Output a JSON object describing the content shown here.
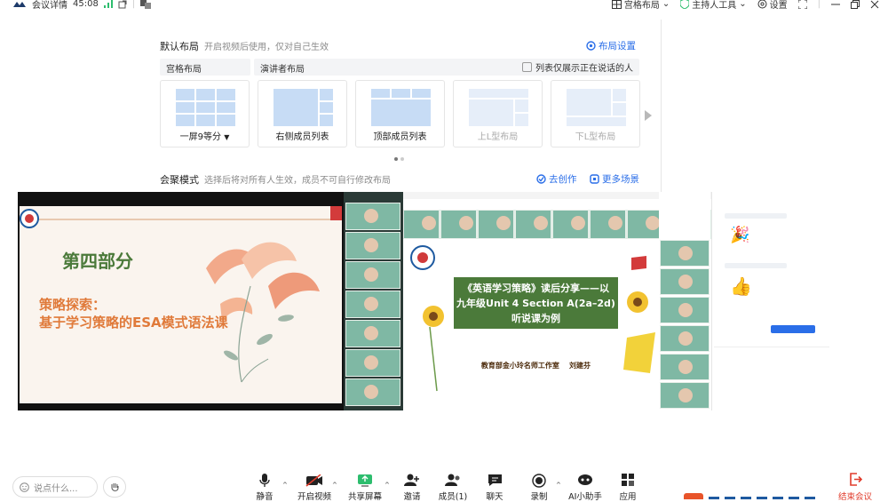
{
  "topbar": {
    "meeting_details": "会议详情",
    "timer": "45:08",
    "grid_layout": "宫格布局",
    "host_agent": "主持人工具",
    "settings": "设置"
  },
  "layout_panel": {
    "default_title": "默认布局",
    "default_sub": "开启视频后使用，仅对自己生效",
    "layout_settings": "布局设置",
    "tab_grid": "宫格布局",
    "tab_speaker": "演讲者布局",
    "only_speaking": "列表仅展示正在说话的人",
    "cards": [
      {
        "label": "一屏9等分",
        "has_menu": true
      },
      {
        "label": "右侧成员列表"
      },
      {
        "label": "顶部成员列表"
      },
      {
        "label": "上L型布局",
        "disabled": true
      },
      {
        "label": "下L型布局",
        "disabled": true
      }
    ],
    "focus_title": "会聚模式",
    "focus_sub": "选择后将对所有人生效，成员不可自行修改布局",
    "go_create": "去创作",
    "more_scenes": "更多场景"
  },
  "slide1": {
    "part": "第四部分",
    "line1": "策略探索：",
    "line2": "基于学习策略的ESA模式语法课"
  },
  "slide2": {
    "title_line1": "《英语学习策略》读后分享——以",
    "title_line2": "九年级Unit 4 Section A(2a–2d)",
    "title_line3": "听说课为例",
    "author": "教育部金小玲名师工作室    刘建芬"
  },
  "toolbar": {
    "say_placeholder": "说点什么...",
    "mute": "静音",
    "video": "开启视频",
    "share": "共享屏幕",
    "invite": "邀请",
    "members": "成员(1)",
    "chat": "聊天",
    "record": "录制",
    "ai": "AI小助手",
    "apps": "应用",
    "end": "结束会议"
  },
  "colors": {
    "accent": "#2a6ee8",
    "end_red": "#e03b2b",
    "slide_green": "#4b7a3a",
    "slide_orange": "#e07a3a"
  }
}
